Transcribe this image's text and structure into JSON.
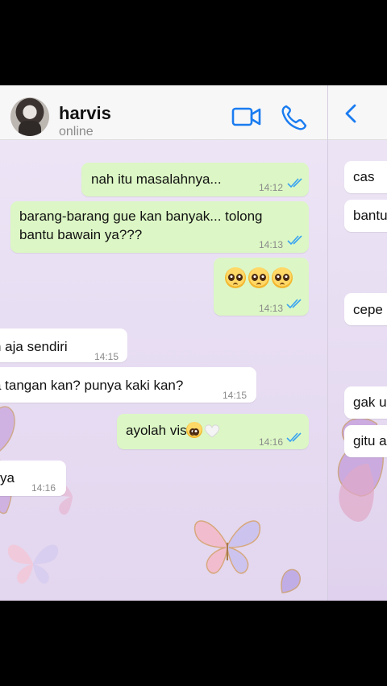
{
  "chat": {
    "contact_name": "harvis",
    "contact_status": "online",
    "messages": [
      {
        "text": "nah itu masalahnya...",
        "time": "14:12"
      },
      {
        "text_line1": "barang-barang gue kan banyak... tolong",
        "text_line2": "bantu bawain ya???",
        "time": "14:13"
      },
      {
        "time": "14:13"
      },
      {
        "text": "n aja sendiri",
        "time": "14:15"
      },
      {
        "text": "a tangan kan? punya kaki kan?",
        "time": "14:15"
      },
      {
        "text": "ayolah vis",
        "time": "14:16"
      },
      {
        "text": "ya",
        "time": "14:16"
      }
    ]
  },
  "right_chat": {
    "messages": [
      "cas",
      "bantu",
      "cepe",
      "gak u",
      "gitu a"
    ]
  },
  "colors": {
    "outgoing_bubble": "#dcf7c5",
    "incoming_bubble": "#ffffff",
    "accent_blue": "#1a7cf0",
    "wallpaper": "#e8def3"
  },
  "icons": [
    "video-call-icon",
    "phone-call-icon",
    "back-chevron-icon",
    "double-check-icon",
    "pleading-face-emoji",
    "white-heart-emoji",
    "butterfly-decoration"
  ]
}
